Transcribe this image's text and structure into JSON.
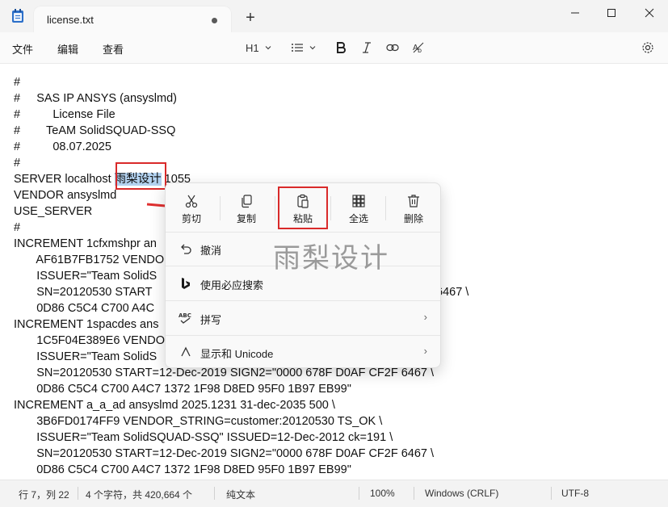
{
  "window": {
    "tab_title": "license.txt",
    "new_tab": "+"
  },
  "menubar": {
    "file": "文件",
    "edit": "编辑",
    "view": "查看",
    "heading": "H1",
    "heading_chevron": "⌄"
  },
  "editor": {
    "lines": [
      "#",
      "#     SAS IP ANSYS (ansyslmd)",
      "#          License File",
      "#        TeAM SolidSQUAD-SSQ",
      "#          08.07.2025",
      "#",
      "SERVER localhost ",
      "VENDOR ansyslmd",
      "USE_SERVER",
      "#",
      "INCREMENT 1cfxmshpr an",
      "       AF61B7FB1752 VENDO",
      "       ISSUER=\"Team SolidS",
      "       SN=20120530 START",
      "       0D86 C5C4 C700 A4C",
      "INCREMENT 1spacdes ans",
      "       1C5F04E389E6 VENDO",
      "       ISSUER=\"Team SolidS",
      "       SN=20120530 START=12-Dec-2019 SIGN2=\"0000 678F D0AF CF2F 6467 \\",
      "       0D86 C5C4 C700 A4C7 1372 1F98 D8ED 95F0 1B97 EB99\"",
      "INCREMENT a_a_ad ansyslmd 2025.1231 31-dec-2035 500 \\",
      "       3B6FD0174FF9 VENDOR_STRING=customer:20120530 TS_OK \\",
      "       ISSUER=\"Team SolidSQUAD-SSQ\" ISSUED=12-Dec-2012 ck=191 \\",
      "       SN=20120530 START=12-Dec-2019 SIGN2=\"0000 678F D0AF CF2F 6467 \\",
      "       0D86 C5C4 C700 A4C7 1372 1F98 D8ED 95F0 1B97 EB99\""
    ],
    "selected_text": "雨梨设计",
    "after_selection": " 1055",
    "partial_right_1": "6467 \\"
  },
  "context_menu": {
    "cut": "剪切",
    "copy": "复制",
    "paste": "粘贴",
    "select_all": "全选",
    "delete": "删除",
    "undo": "撤消",
    "bing_search": "使用必应搜索",
    "spelling": "拼写",
    "unicode": "显示和 Unicode",
    "chevron": "›"
  },
  "watermark": "雨梨设计",
  "statusbar": {
    "position": "行 7，列 22",
    "chars": "4 个字符，共 420,664 个",
    "format": "纯文本",
    "zoom": "100%",
    "line_ending": "Windows (CRLF)",
    "encoding": "UTF-8"
  },
  "colors": {
    "highlight_border": "#d92a2a",
    "selection": "#b3d2f0",
    "arrow": "#e03030"
  }
}
